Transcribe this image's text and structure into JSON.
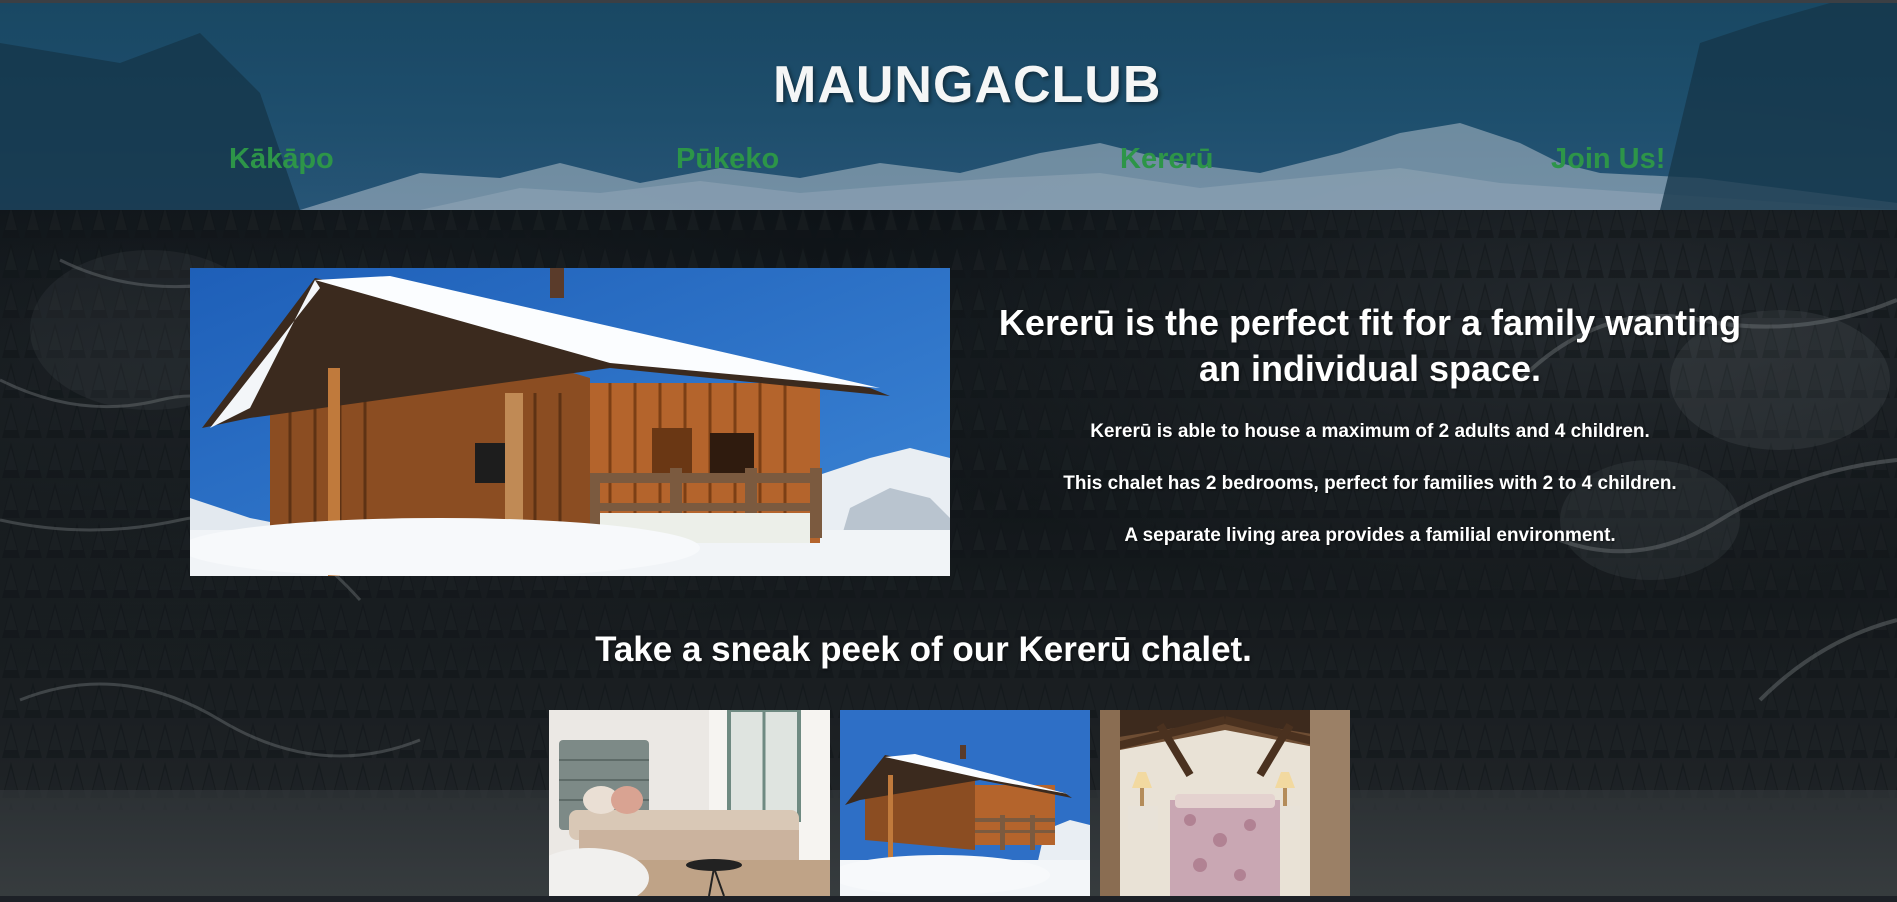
{
  "brand": {
    "logo_text": "MAUNGACLUB"
  },
  "nav": {
    "items": [
      {
        "label": "Kākāpo"
      },
      {
        "label": "Pūkeko"
      },
      {
        "label": "Kererū"
      },
      {
        "label": "Join Us!"
      }
    ],
    "link_color": "#2e9a4a"
  },
  "intro": {
    "heading": "Kererū is the perfect fit for a family wanting an individual space.",
    "paragraphs": [
      "Kererū is able to house a maximum of 2 adults and 4 children.",
      "This chalet has 2 bedrooms, perfect for families with 2 to 4 children.",
      "A separate living area provides a familial environment."
    ]
  },
  "gallery": {
    "heading": "Take a sneak peek of our Kererū chalet.",
    "thumbnails": [
      {
        "subject": "bedroom-with-daybed"
      },
      {
        "subject": "snowy-chalet-exterior"
      },
      {
        "subject": "attic-bedroom-with-lamps"
      }
    ]
  },
  "colors": {
    "header_bg": "#1f5170",
    "text": "#ffffff",
    "nav": "#2e9a4a"
  }
}
